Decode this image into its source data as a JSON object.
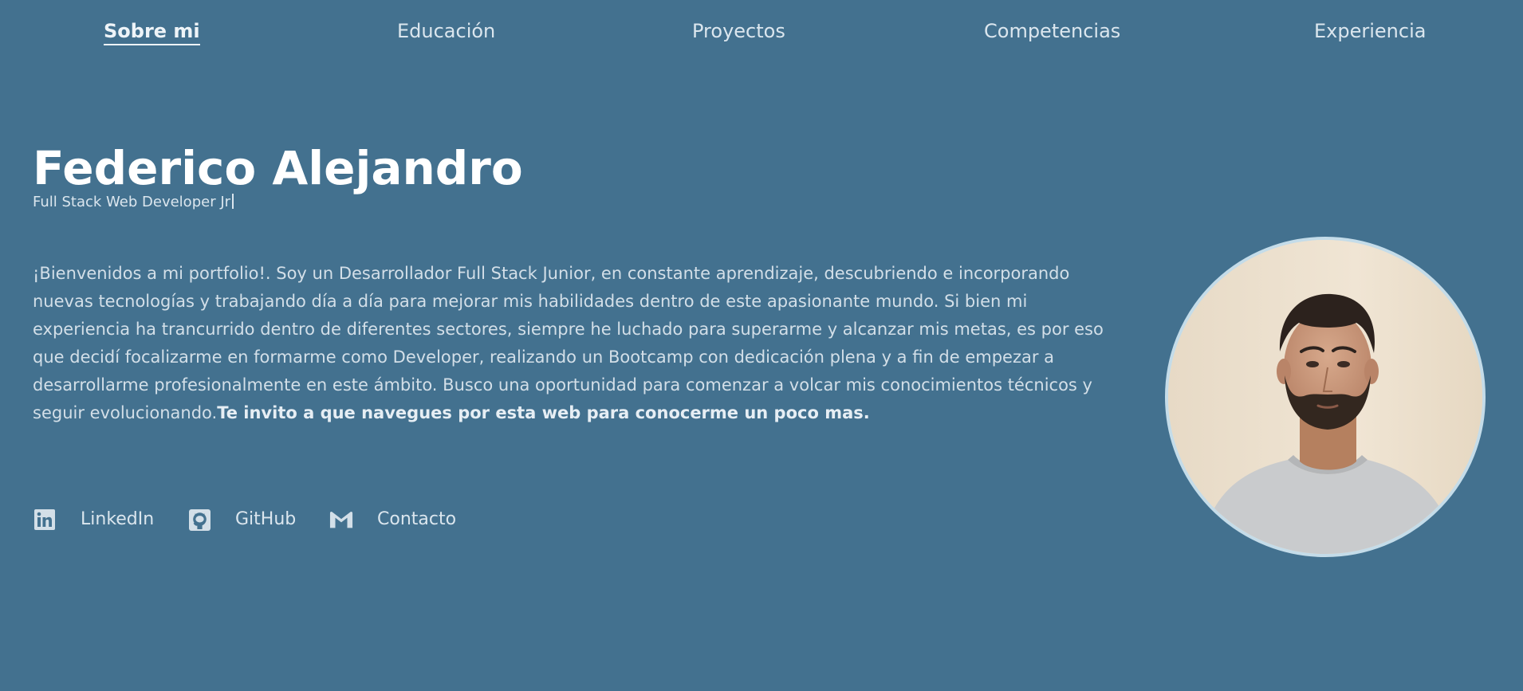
{
  "nav": {
    "items": [
      {
        "label": "Sobre mi",
        "active": true
      },
      {
        "label": "Educación",
        "active": false
      },
      {
        "label": "Proyectos",
        "active": false
      },
      {
        "label": "Competencias",
        "active": false
      },
      {
        "label": "Experiencia",
        "active": false
      }
    ]
  },
  "hero": {
    "name": "Federico Alejandro",
    "subtitle": "Full Stack Web Developer Jr",
    "bio": "¡Bienvenidos a mi portfolio!. Soy un Desarrollador Full Stack Junior, en constante aprendizaje, descubriendo e incorporando nuevas tecnologías y trabajando día a día para mejorar mis habilidades dentro de este apasionante mundo. Si bien mi experiencia ha trancurrido dentro de diferentes sectores, siempre he luchado para superarme y alcanzar mis metas, es por eso que decidí focalizarme en formarme como Developer, realizando un Bootcamp con dedicación plena y a fin de empezar a desarrollarme profesionalmente en este ámbito. Busco una oportunidad para comenzar a volcar mis conocimientos técnicos y seguir evolucionando.",
    "bio_highlight": "Te invito a que navegues por esta web para conocerme un poco mas."
  },
  "social": [
    {
      "label": "LinkedIn",
      "icon": "linkedin-icon"
    },
    {
      "label": "GitHub",
      "icon": "github-icon"
    },
    {
      "label": "Contacto",
      "icon": "gmail-icon"
    }
  ],
  "photo": {
    "icon": "profile-photo"
  },
  "colors": {
    "background": "#43718f",
    "text": "#dbe6ee",
    "heading": "#ffffff",
    "photo_border": "#c4dce9"
  }
}
